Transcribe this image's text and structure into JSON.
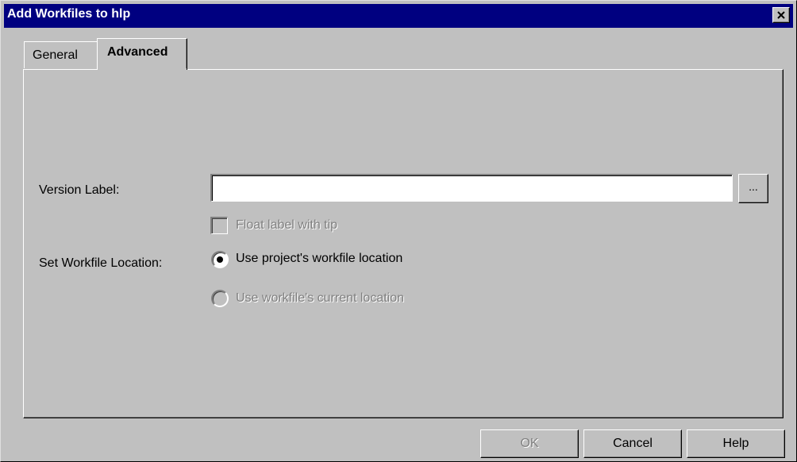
{
  "window": {
    "title": "Add Workfiles to hlp",
    "close_icon": "close-icon"
  },
  "tabs": [
    {
      "label": "General",
      "active": false
    },
    {
      "label": "Advanced",
      "active": true
    }
  ],
  "form": {
    "version_label": {
      "label": "Version Label:",
      "value": "",
      "browse_label": "..."
    },
    "float_label": {
      "label": "Float label with tip",
      "checked": false,
      "enabled": false
    },
    "workfile_location": {
      "label": "Set Workfile Location:",
      "options": [
        {
          "label": "Use project's workfile location",
          "selected": true,
          "enabled": true
        },
        {
          "label": "Use workfile's current location",
          "selected": false,
          "enabled": false
        }
      ]
    }
  },
  "buttons": {
    "ok": {
      "label": "OK",
      "enabled": false
    },
    "cancel": {
      "label": "Cancel",
      "enabled": true
    },
    "help": {
      "label": "Help",
      "enabled": true
    }
  },
  "colors": {
    "titlebar": "#000080",
    "face": "#c0c0c0",
    "disabled_text": "#808080"
  }
}
